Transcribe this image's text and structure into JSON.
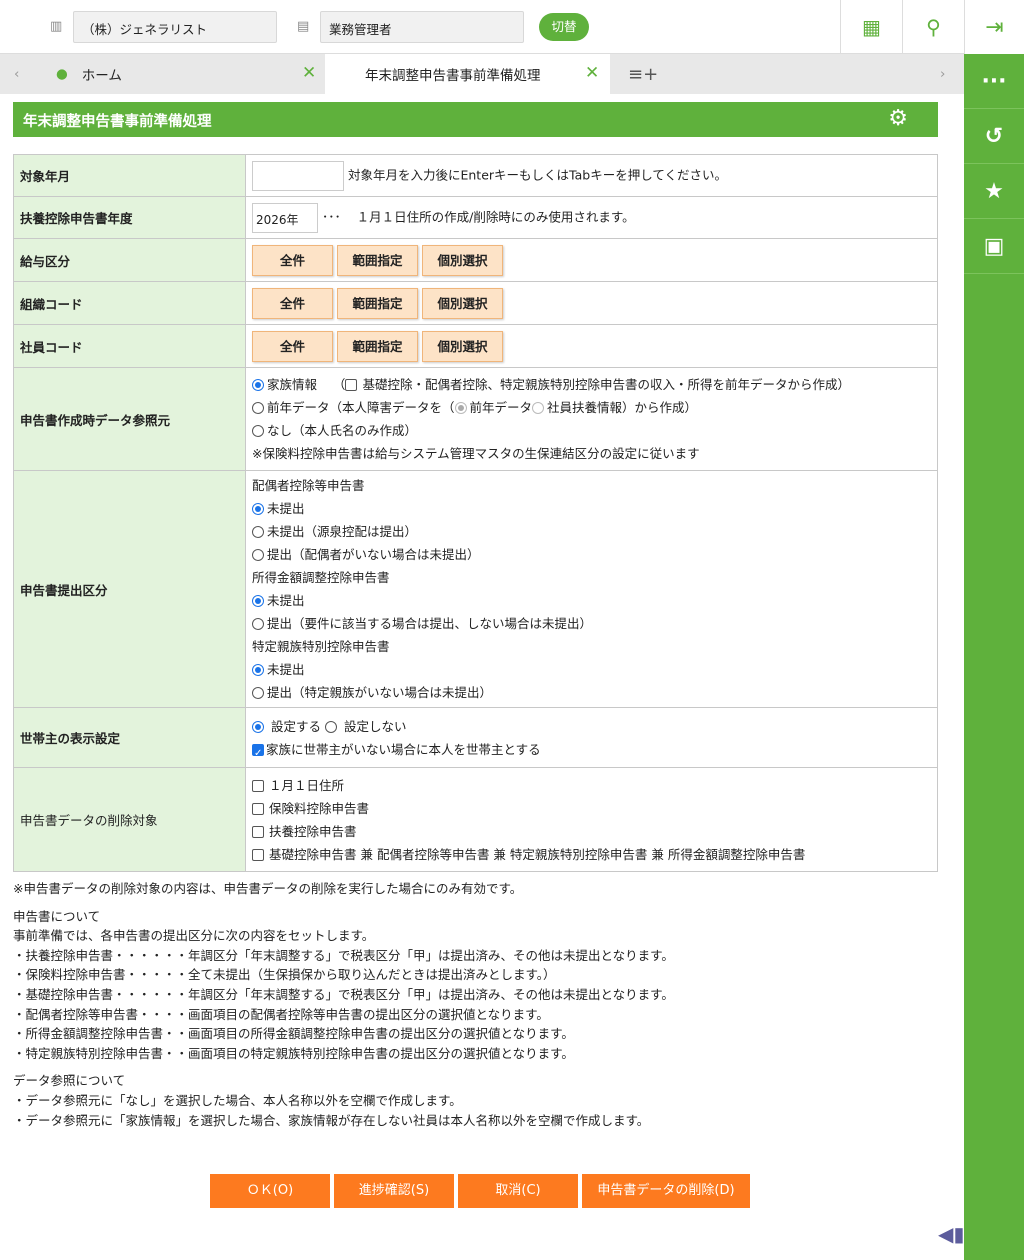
{
  "header": {
    "company": "（株）ジェネラリスト",
    "role": "業務管理者",
    "switch_label": "切替"
  },
  "tabs": [
    {
      "label": "ホーム"
    },
    {
      "label": "年末調整申告書事前準備処理"
    }
  ],
  "page_title": "年末調整申告書事前準備処理",
  "form": {
    "target_month": {
      "label": "対象年月",
      "value": "",
      "hint": "対象年月を入力後にEnterキーもしくはTabキーを押してください。"
    },
    "year": {
      "label": "扶養控除申告書年度",
      "value": "2026年",
      "ellipsis": "･･･",
      "hint": "１月１日住所の作成/削除時にのみ使用されます。"
    },
    "range_rows": [
      {
        "label": "給与区分"
      },
      {
        "label": "組織コード"
      },
      {
        "label": "社員コード"
      }
    ],
    "range_buttons": [
      "全件",
      "範囲指定",
      "個別選択"
    ],
    "source": {
      "label": "申告書作成時データ参照元",
      "family": "家族情報",
      "family_opt": "基礎控除・配偶者控除、特定親族特別控除申告書の収入・所得を前年データから作成",
      "open": "（",
      "close": "）",
      "prev": "前年データ（本人障害データを（",
      "prev_a": "前年データ",
      "prev_b": "社員扶養情報）から作成）",
      "none": "なし（本人氏名のみ作成）",
      "note": "※保険料控除申告書は給与システム管理マスタの生保連結区分の設定に従います"
    },
    "submit": {
      "label": "申告書提出区分",
      "groups": [
        {
          "title": "配偶者控除等申告書",
          "options": [
            "未提出",
            "未提出（源泉控配は提出）",
            "提出（配偶者がいない場合は未提出）"
          ]
        },
        {
          "title": "所得金額調整控除申告書",
          "options": [
            "未提出",
            "提出（要件に該当する場合は提出、しない場合は未提出）"
          ]
        },
        {
          "title": "特定親族特別控除申告書",
          "options": [
            "未提出",
            "提出（特定親族がいない場合は未提出）"
          ]
        }
      ]
    },
    "householder": {
      "label": "世帯主の表示設定",
      "set": "設定する",
      "unset": "設定しない",
      "check": "家族に世帯主がいない場合に本人を世帯主とする"
    },
    "delete": {
      "label": "申告書データの削除対象",
      "items": [
        "１月１日住所",
        "保険料控除申告書",
        "扶養控除申告書",
        "基礎控除申告書 兼 配偶者控除等申告書 兼 特定親族特別控除申告書 兼 所得金額調整控除申告書"
      ]
    }
  },
  "notes": [
    "※申告書データの削除対象の内容は、申告書データの削除を実行した場合にのみ有効です。",
    "",
    "申告書について",
    "事前準備では、各申告書の提出区分に次の内容をセットします。",
    "・扶養控除申告書・・・・・・年調区分「年末調整する」で税表区分「甲」は提出済み、その他は未提出となります。",
    "・保険料控除申告書・・・・・全て未提出（生保損保から取り込んだときは提出済みとします。）",
    "・基礎控除申告書・・・・・・年調区分「年末調整する」で税表区分「甲」は提出済み、その他は未提出となります。",
    "・配偶者控除等申告書・・・・画面項目の配偶者控除等申告書の提出区分の選択値となります。",
    "・所得金額調整控除申告書・・画面項目の所得金額調整控除申告書の提出区分の選択値となります。",
    "・特定親族特別控除申告書・・画面項目の特定親族特別控除申告書の提出区分の選択値となります。",
    "",
    "データ参照について",
    "・データ参照元に「なし」を選択した場合、本人名称以外を空欄で作成します。",
    "・データ参照元に「家族情報」を選択した場合、家族情報が存在しない社員は本人名称以外を空欄で作成します。"
  ],
  "buttons": {
    "ok": "ＯＫ(O)",
    "progress": "進捗確認(S)",
    "cancel": "取消(C)",
    "delete": "申告書データの削除(D)"
  }
}
